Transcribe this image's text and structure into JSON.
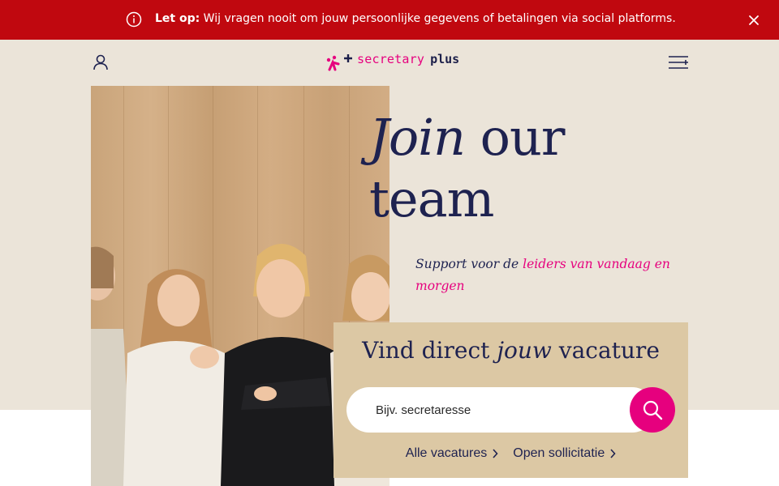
{
  "alert": {
    "label": "Let op:",
    "message": " Wij vragen nooit om jouw persoonlijke gegevens of betalingen via social platforms."
  },
  "logo": {
    "word1": "secretary",
    "word2": "plus"
  },
  "hero": {
    "headline_italic": "Join",
    "headline_rest1": " our",
    "headline_rest2": "team",
    "sub_plain": "Support voor de ",
    "sub_highlight": "leiders van vandaag en morgen"
  },
  "search": {
    "title_before": "Vind direct ",
    "title_italic": "jouw",
    "title_after": " vacature",
    "placeholder": "Bijv. secretaresse",
    "link_all": "Alle vacatures",
    "link_open": "Open sollicitatie"
  },
  "colors": {
    "alert_bg": "#c0080f",
    "brand_pink": "#e6007e",
    "navy": "#1e2250",
    "hero_bg": "#ebe4d9",
    "card_bg": "#dcc8a4"
  },
  "icons": [
    "info-icon",
    "close-icon",
    "user-icon",
    "menu-icon",
    "search-icon",
    "chevron-right-icon"
  ]
}
